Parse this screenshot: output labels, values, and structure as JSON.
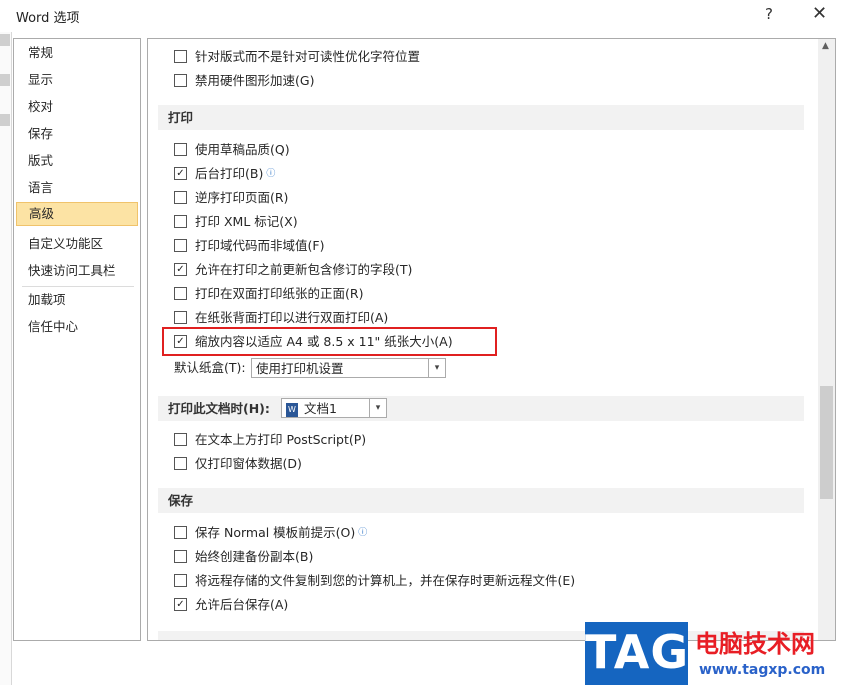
{
  "window": {
    "title": "Word 选项",
    "help_glyph": "?",
    "close_glyph": "✕"
  },
  "nav": {
    "items": [
      "常规",
      "显示",
      "校对",
      "保存",
      "版式",
      "语言",
      "高级",
      "自定义功能区",
      "快速访问工具栏",
      "加载项",
      "信任中心"
    ],
    "active": "高级"
  },
  "options": {
    "top_items": [
      {
        "label": "针对版式而不是针对可读性优化字符位置",
        "checked": false
      },
      {
        "label": "禁用硬件图形加速(G)",
        "checked": false
      }
    ],
    "print_section": {
      "header": "打印",
      "items": [
        {
          "label": "使用草稿品质(Q)",
          "checked": false
        },
        {
          "label": "后台打印(B)",
          "checked": true,
          "info": true
        },
        {
          "label": "逆序打印页面(R)",
          "checked": false
        },
        {
          "label": "打印 XML 标记(X)",
          "checked": false
        },
        {
          "label": "打印域代码而非域值(F)",
          "checked": false
        },
        {
          "label": "允许在打印之前更新包含修订的字段(T)",
          "checked": true
        },
        {
          "label": "打印在双面打印纸张的正面(R)",
          "checked": false
        },
        {
          "label": "在纸张背面打印以进行双面打印(A)",
          "checked": false
        },
        {
          "label": "缩放内容以适应 A4 或 8.5 x 11\" 纸张大小(A)",
          "checked": true,
          "highlighted": true
        }
      ],
      "tray_label": "默认纸盒(T):",
      "tray_value": "使用打印机设置"
    },
    "print_doc_section": {
      "header": "打印此文档时(H):",
      "doc_value": "文档1",
      "items": [
        {
          "label": "在文本上方打印 PostScript(P)",
          "checked": false
        },
        {
          "label": "仅打印窗体数据(D)",
          "checked": false
        }
      ]
    },
    "save_section": {
      "header": "保存",
      "items": [
        {
          "label": "保存 Normal 模板前提示(O)",
          "checked": false,
          "info": true
        },
        {
          "label": "始终创建备份副本(B)",
          "checked": false
        },
        {
          "label": "将远程存储的文件复制到您的计算机上，并在保存时更新远程文件(E)",
          "checked": false
        },
        {
          "label": "允许后台保存(A)",
          "checked": true
        }
      ]
    }
  },
  "icons": {
    "check": "✓",
    "info": "ⓘ",
    "dropdown": "▾",
    "scroll_up": "▲"
  },
  "watermark": {
    "tag": "TAG",
    "site_name": "电脑技术网",
    "url": "www.tagxp.com"
  },
  "colors": {
    "active_nav_bg": "#fce3a4",
    "highlight_border": "#e02020",
    "watermark_blue": "#1565c0",
    "watermark_red": "#e81e25"
  }
}
